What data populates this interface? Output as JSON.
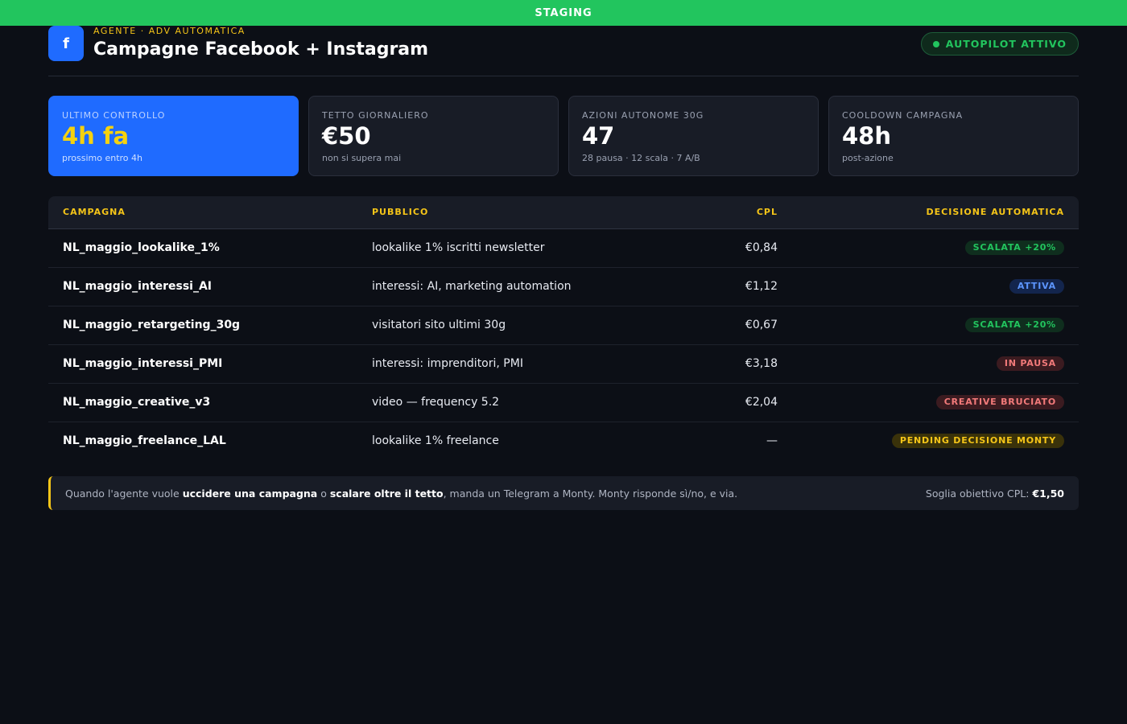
{
  "env_banner": "STAGING",
  "header": {
    "logo_letter": "f",
    "eyebrow": "AGENTE · ADV AUTOMATICA",
    "title": "Campagne Facebook + Instagram",
    "status_pill": "AUTOPILOT ATTIVO"
  },
  "cards": [
    {
      "label": "ULTIMO CONTROLLO",
      "value": "4h fa",
      "sub": "prossimo entro 4h"
    },
    {
      "label": "TETTO GIORNALIERO",
      "value": "€50",
      "sub": "non si supera mai"
    },
    {
      "label": "AZIONI AUTONOME 30G",
      "value": "47",
      "sub": "28 pausa · 12 scala · 7 A/B"
    },
    {
      "label": "COOLDOWN CAMPAGNA",
      "value": "48h",
      "sub": "post-azione"
    }
  ],
  "table": {
    "headers": {
      "campaign": "CAMPAGNA",
      "audience": "PUBBLICO",
      "cpl": "CPL",
      "decision": "DECISIONE AUTOMATICA"
    },
    "rows": [
      {
        "campaign": "NL_maggio_lookalike_1%",
        "audience": "lookalike 1% iscritti newsletter",
        "cpl": "€0,84",
        "decision": "SCALATA +20%"
      },
      {
        "campaign": "NL_maggio_interessi_AI",
        "audience": "interessi: AI, marketing automation",
        "cpl": "€1,12",
        "decision": "ATTIVA"
      },
      {
        "campaign": "NL_maggio_retargeting_30g",
        "audience": "visitatori sito ultimi 30g",
        "cpl": "€0,67",
        "decision": "SCALATA +20%"
      },
      {
        "campaign": "NL_maggio_interessi_PMI",
        "audience": "interessi: imprenditori, PMI",
        "cpl": "€3,18",
        "decision": "IN PAUSA"
      },
      {
        "campaign": "NL_maggio_creative_v3",
        "audience": "video — frequency 5.2",
        "cpl": "€2,04",
        "decision": "CREATIVE BRUCIATO"
      },
      {
        "campaign": "NL_maggio_freelance_LAL",
        "audience": "lookalike 1% freelance",
        "cpl": "—",
        "decision": "PENDING DECISIONE MONTY"
      }
    ]
  },
  "notice": {
    "t1": "Quando l'agente vuole ",
    "b1": "uccidere una campagna",
    "t2": " o ",
    "b2": "scalare oltre il tetto",
    "t3": ", manda un Telegram a Monty. Monty risponde sì/no, e via.",
    "threshold_label": "Soglia obiettivo CPL: ",
    "threshold_value": "€1,50"
  },
  "colors": {
    "accent_blue": "#1f6bff",
    "accent_yellow": "#f5c518",
    "success_green": "#22c55e",
    "danger_red": "#f27a7a",
    "background": "#0c0f16"
  }
}
